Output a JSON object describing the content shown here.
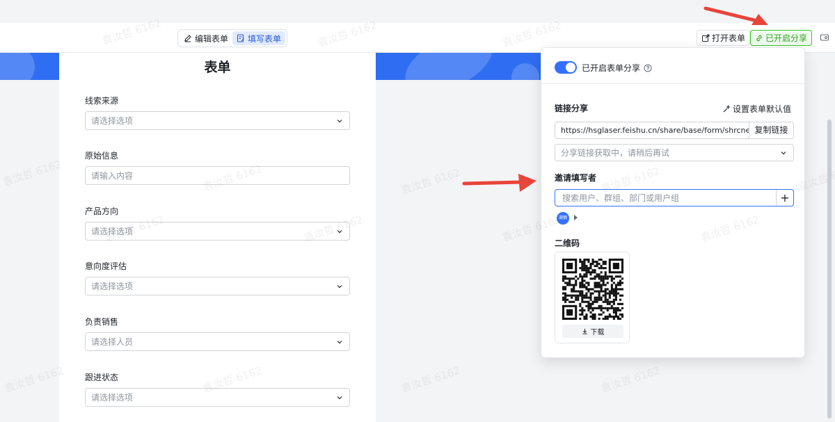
{
  "toolbar": {
    "edit_form_label": "编辑表单",
    "fill_form_label": "填写表单",
    "open_form_label": "打开表单",
    "share_enabled_label": "已开启分享"
  },
  "form": {
    "title": "表单",
    "fields": [
      {
        "label": "线索来源",
        "placeholder": "请选择选项",
        "type": "select"
      },
      {
        "label": "原始信息",
        "placeholder": "请输入内容",
        "type": "text"
      },
      {
        "label": "产品方向",
        "placeholder": "请选择选项",
        "type": "select"
      },
      {
        "label": "意向度评估",
        "placeholder": "请选择选项",
        "type": "select"
      },
      {
        "label": "负责销售",
        "placeholder": "请选择人员",
        "type": "select"
      },
      {
        "label": "跟进状态",
        "placeholder": "请选择选项",
        "type": "select"
      }
    ]
  },
  "share_panel": {
    "toggle_label": "已开启表单分享",
    "toggle_on": true,
    "link_share_title": "链接分享",
    "set_default_label": "设置表单默认值",
    "link_url": "https://hsglaser.feishu.cn/share/base/form/shrcneVbd",
    "copy_link_label": "复制链接",
    "permission_placeholder": "分享链接获取中，请稍后再试",
    "invite_title": "邀请填写者",
    "invite_placeholder": "搜索用户、群组、部门或用户组",
    "avatar_text": "湖钢",
    "qr_title": "二维码",
    "download_label": "下载"
  },
  "watermark_text": "袁汝哲 6162",
  "colors": {
    "accent": "#3370ff",
    "share_green": "#2ea121",
    "banner": "#2f6ef2",
    "annotation_arrow": "#e8443a"
  }
}
